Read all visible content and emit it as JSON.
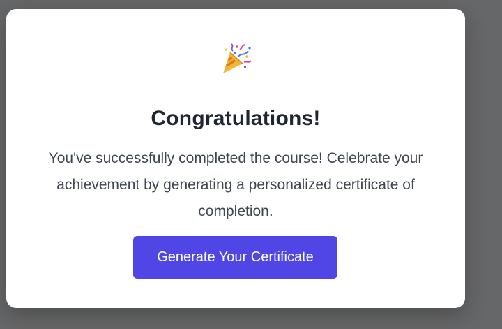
{
  "modal": {
    "icon": "party-popper-icon",
    "title": "Congratulations!",
    "message": "You've successfully completed the course! Celebrate your achievement by generating a personalized certificate of completion.",
    "cta_label": "Generate Your Certificate"
  },
  "colors": {
    "backdrop": "#666768",
    "modal_bg": "#ffffff",
    "title": "#1f2633",
    "text": "#3f4652",
    "accent": "#4f46e5"
  }
}
